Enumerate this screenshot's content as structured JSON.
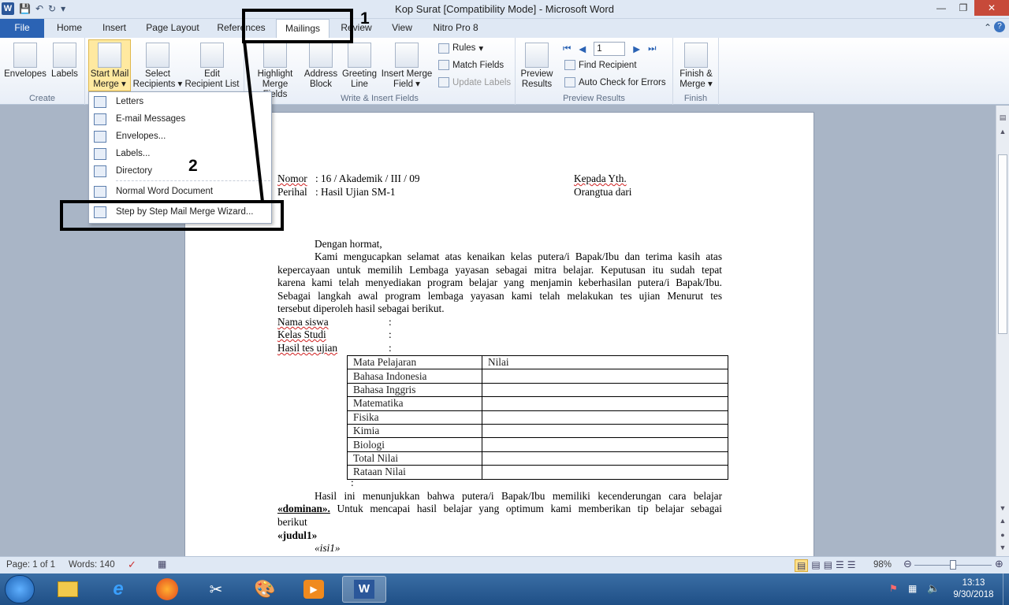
{
  "window": {
    "title": "Kop Surat [Compatibility Mode]  -  Microsoft Word"
  },
  "tabs": [
    "File",
    "Home",
    "Insert",
    "Page Layout",
    "References",
    "Mailings",
    "Review",
    "View",
    "Nitro Pro 8"
  ],
  "ribbon": {
    "create": {
      "envelopes": "Envelopes",
      "labels": "Labels",
      "group": "Create"
    },
    "start": {
      "start_mail": "Start Mail",
      "merge": "Merge",
      "select": "Select",
      "recipients": "Recipients",
      "edit": "Edit",
      "recipient_list": "Recipient List",
      "group": ""
    },
    "write": {
      "highlight": "Highlight",
      "merge_fields": "Merge Fields",
      "address": "Address",
      "block": "Block",
      "greeting": "Greeting",
      "line": "Line",
      "insert_merge": "Insert Merge",
      "field": "Field",
      "rules": "Rules",
      "match_fields": "Match Fields",
      "update_labels": "Update Labels",
      "group": "Write & Insert Fields"
    },
    "preview": {
      "preview": "Preview",
      "results": "Results",
      "record": "1",
      "find": "Find Recipient",
      "auto_check": "Auto Check for Errors",
      "group": "Preview Results"
    },
    "finish": {
      "finish": "Finish &",
      "merge": "Merge",
      "group": "Finish"
    }
  },
  "dropdown": {
    "letters": "Letters",
    "email": "E-mail Messages",
    "envelopes": "Envelopes...",
    "labels": "Labels...",
    "directory": "Directory",
    "normal": "Normal Word Document",
    "wizard": "Step by Step Mail Merge Wizard..."
  },
  "annotations": {
    "one": "1",
    "two": "2"
  },
  "document": {
    "nomor_label": "Nomor",
    "nomor_value": ": 16 / Akademik / III / 09",
    "perihal_label": "Perihal",
    "perihal_value": ": Hasil Ujian SM-1",
    "kepada": "Kepada Yth.",
    "orangtua": "Orangtua dari",
    "salam": "Dengan hormat,",
    "p1_l1": "Kami mengucapkan selamat atas kenaikan kelas putera/i Bapak/Ibu dan terima kasih atas",
    "p1_l2": "kepercayaan untuk memilih Lembaga yayasan sebagai mitra belajar. Keputusan itu sudah tepat",
    "p1_l3": "karena kami telah menyediakan program belajar yang menjamin keberhasilan putera/i Bapak/Ibu.",
    "p1_l4": "Sebagai langkah awal program lembaga yayasan kami telah melakukan tes ujian Menurut tes",
    "p1_l5": "tersebut diperoleh hasil sebagai berikut.",
    "nama": "Nama siswa",
    "kelas": "Kelas Studi",
    "hasil": "Hasil tes ujian",
    "colon": ":",
    "table": {
      "headers": [
        "Mata Pelajaran",
        "Nilai"
      ],
      "rows": [
        "Bahasa Indonesia",
        "Bahasa Inggris",
        "Matematika",
        "Fisika",
        "Kimia",
        "Biologi",
        "Total Nilai",
        "Rataan Nilai"
      ]
    },
    "after_colon": ":",
    "p2_l1": "Hasil ini menunjukkan bahwa putera/i Bapak/Ibu memiliki kecenderungan cara belajar",
    "p2_dominan": "«dominan».",
    "p2_l2_rest": " Untuk mencapai hasil belajar yang optimum kami memberikan tip belajar sebagai",
    "p2_l3": "berikut",
    "judul": "«judul1»",
    "isi": "«isi1»"
  },
  "status": {
    "page": "Page: 1 of 1",
    "words": "Words: 140",
    "zoom": "98%"
  },
  "tray": {
    "time": "13:13",
    "date": "9/30/2018"
  }
}
